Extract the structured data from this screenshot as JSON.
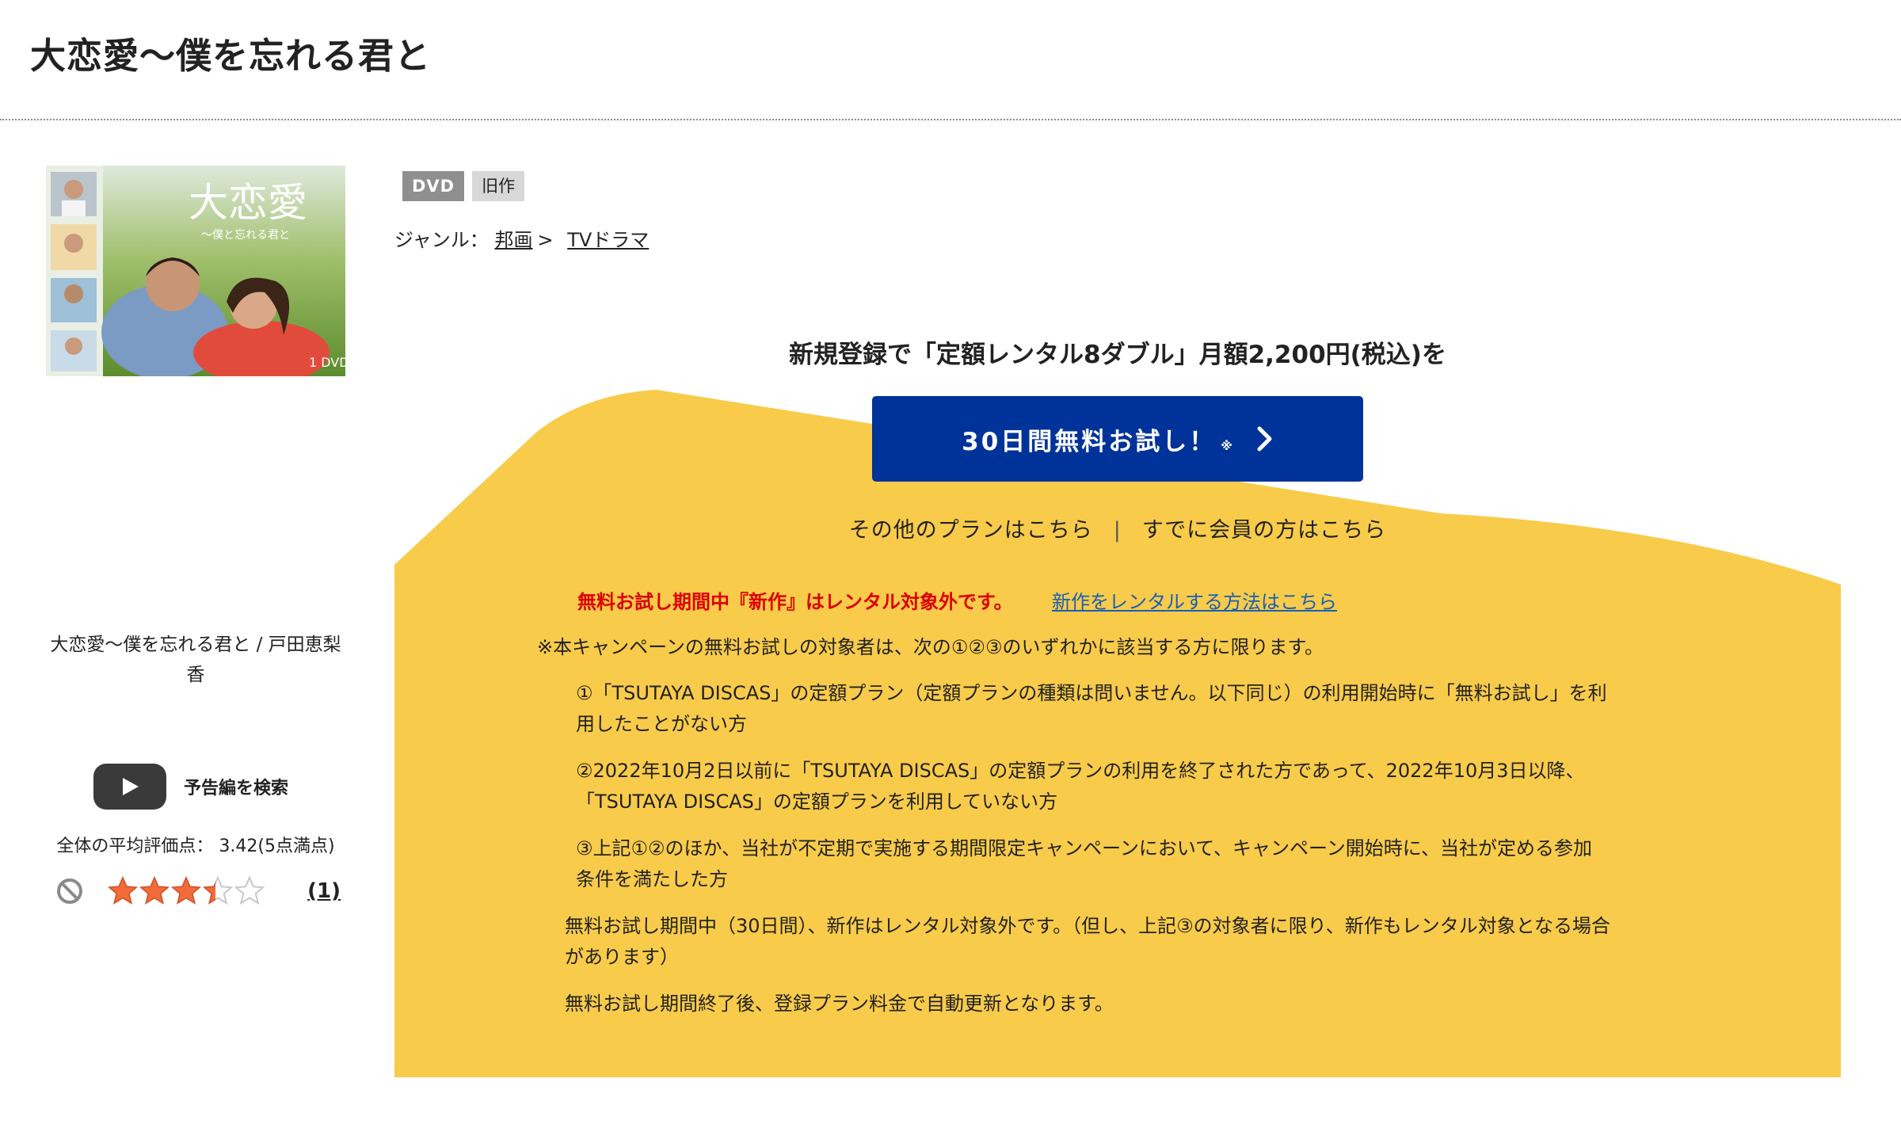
{
  "page": {
    "title": "大恋愛〜僕を忘れる君と"
  },
  "cover": {
    "title_art": "大恋愛",
    "subtitle_art": "〜僕と忘れる君と",
    "disc_label": "1 DVD",
    "caption": "大恋愛〜僕を忘れる君と / 戸田恵梨香"
  },
  "trailer": {
    "label": "予告編を検索",
    "icon": "play-icon"
  },
  "rating": {
    "average_text": "全体の平均評価点： 3.42(5点満点)",
    "average_value": 3.42,
    "max": 5,
    "review_count": "(1)"
  },
  "badges": {
    "format": "DVD",
    "type": "旧作"
  },
  "genre": {
    "label": "ジャンル：",
    "primary": "邦画",
    "separator": ">",
    "secondary": "TVドラマ"
  },
  "promo": {
    "heading": "新規登録で「定額レンタル8ダブル」月額2,200円(税込)を",
    "cta_label": "30日間無料お試し！",
    "cta_note": "※",
    "other_plans": "その他のプランはこちら",
    "divider": "|",
    "members_link": "すでに会員の方はこちら",
    "red_notice": "無料お試し期間中『新作』はレンタル対象外です。",
    "red_notice_link": "新作をレンタルする方法はこちら",
    "terms_intro": "※本キャンペーンの無料お試しの対象者は、次の①②③のいずれかに該当する方に限ります。",
    "term1_line1": "①「TSUTAYA DISCAS」の定額プラン（定額プランの種類は問いません。以下同じ）の利用開始時に「無料お試し」を利",
    "term1_line2": "用したことがない方",
    "term2_line1": "②2022年10月2日以前に「TSUTAYA DISCAS」の定額プランの利用を終了された方であって、2022年10月3日以降、",
    "term2_line2": "「TSUTAYA DISCAS」の定額プランを利用していない方",
    "term3_line1": "③上記①②のほか、当社が不定期で実施する期間限定キャンペーンにおいて、キャンペーン開始時に、当社が定める参加",
    "term3_line2": "条件を満たした方",
    "note1_line1": "無料お試し期間中（30日間）、新作はレンタル対象外です。（但し、上記③の対象者に限り、新作もレンタル対象となる場合",
    "note1_line2": "があります）",
    "note2": "無料お試し期間終了後、登録プラン料金で自動更新となります。"
  },
  "colors": {
    "promo_yellow": "#f8cb4a",
    "cta_blue": "#003399",
    "notice_red": "#dd0000",
    "link_blue": "#1a5fb4",
    "star_orange": "#f26b3a"
  }
}
